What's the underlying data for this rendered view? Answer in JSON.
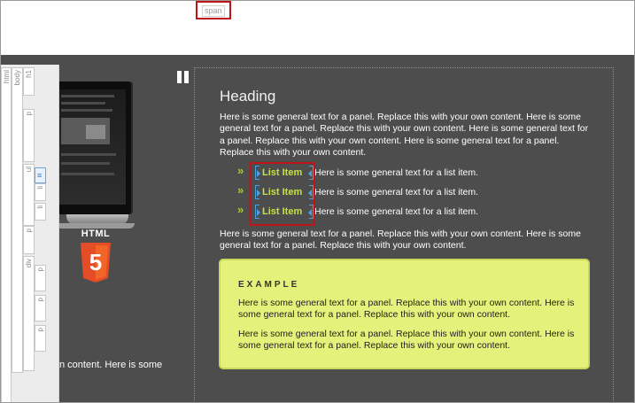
{
  "selection_tag": {
    "label": "span"
  },
  "ruler": {
    "tags": [
      "html",
      "body",
      "h1",
      "p",
      "ul",
      "li",
      "li",
      "p",
      "div",
      "p",
      "p",
      "p"
    ]
  },
  "left_panel": {
    "logo_text": "HTML",
    "logo_number": "5",
    "partial_text": "n content. Here is some"
  },
  "panel": {
    "heading": "Heading",
    "paragraph1": "Here is some general text for a panel. Replace this with your own content. Here is some general text for a panel. Replace this with your own content. Here is some general text for a panel. Replace this with your own content. Here is some general text for a panel. Replace this with your own content.",
    "list_items": [
      {
        "label": "List Item",
        "text": "Here is some general text for a list item."
      },
      {
        "label": "List Item",
        "text": "Here is some general text for a list item."
      },
      {
        "label": "List Item",
        "text": "Here is some general text for a list item."
      }
    ],
    "bullet": "»",
    "paragraph2": "Here is some general text for a panel. Replace this with your own content. Here is some general text for a panel. Replace this with your own content.",
    "example": {
      "title": "EXAMPLE",
      "paragraph1": "Here is some general text for a panel. Replace this with your own content. Here is some general text for a panel. Replace this with your own content.",
      "paragraph2": "Here is some general text for a panel. Replace this with your own content. Here is some general text for a panel. Replace this with your own content."
    }
  },
  "colors": {
    "canvas": "#4d4d4d",
    "accent_green": "#c6e04a",
    "example_bg": "#e5f17a",
    "selection_red": "#c0141b",
    "bracket_blue": "#4aa3e0",
    "html5_orange": "#e44d26"
  }
}
